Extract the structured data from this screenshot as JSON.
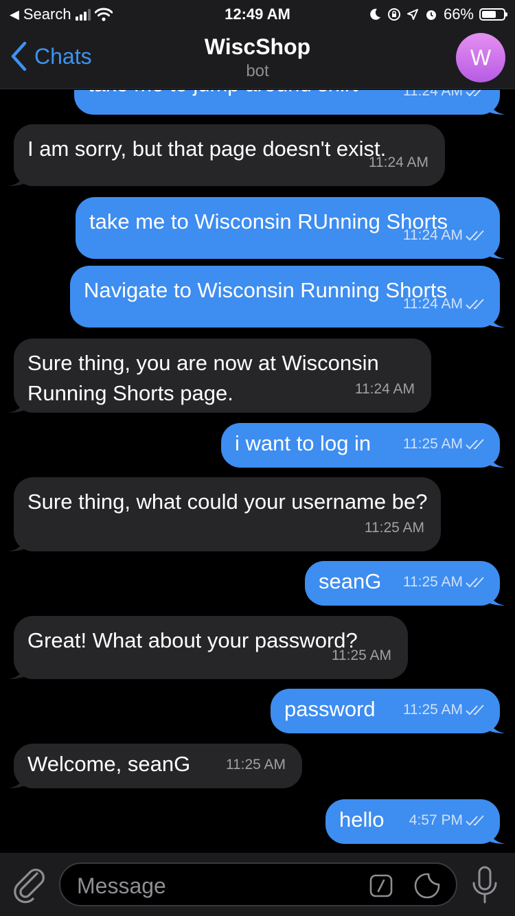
{
  "status_bar": {
    "back_app": "Search",
    "time": "12:49 AM",
    "battery": "66%",
    "battery_level": 0.66
  },
  "header": {
    "back_label": "Chats",
    "title": "WiscShop",
    "subtitle": "bot",
    "avatar_initial": "W"
  },
  "messages": [
    {
      "direction": "out",
      "text": "take me to jump around shirt",
      "time": "11:24 AM"
    },
    {
      "direction": "in",
      "text": "I am sorry, but that page doesn't exist.",
      "time": "11:24 AM"
    },
    {
      "direction": "out",
      "text": "take me to Wisconsin RUnning Shorts",
      "time": "11:24 AM"
    },
    {
      "direction": "out",
      "text": "Navigate to Wisconsin Running Shorts",
      "time": "11:24 AM"
    },
    {
      "direction": "in",
      "text": "Sure thing, you are now at Wisconsin Running Shorts page.",
      "time": "11:24 AM"
    },
    {
      "direction": "out",
      "text": "i want to log in",
      "time": "11:25 AM"
    },
    {
      "direction": "in",
      "text": "Sure thing, what could your username be?",
      "time": "11:25 AM"
    },
    {
      "direction": "out",
      "text": "seanG",
      "time": "11:25 AM"
    },
    {
      "direction": "in",
      "text": "Great! What about your password?",
      "time": "11:25 AM"
    },
    {
      "direction": "out",
      "text": "password",
      "time": "11:25 AM"
    },
    {
      "direction": "in",
      "text": "Welcome, seanG",
      "time": "11:25 AM"
    },
    {
      "direction": "out",
      "text": "hello",
      "time": "4:57 PM"
    }
  ],
  "composer": {
    "placeholder": "Message"
  },
  "icons": {
    "back": "chevron-left-icon",
    "attach": "paperclip-icon",
    "commands": "slash-command-icon",
    "sticker": "sticker-icon",
    "mic": "microphone-icon",
    "read": "double-check-icon"
  },
  "colors": {
    "outgoing": "#3e8df0",
    "incoming": "#262628",
    "accent": "#3e93f0",
    "background": "#000000"
  }
}
